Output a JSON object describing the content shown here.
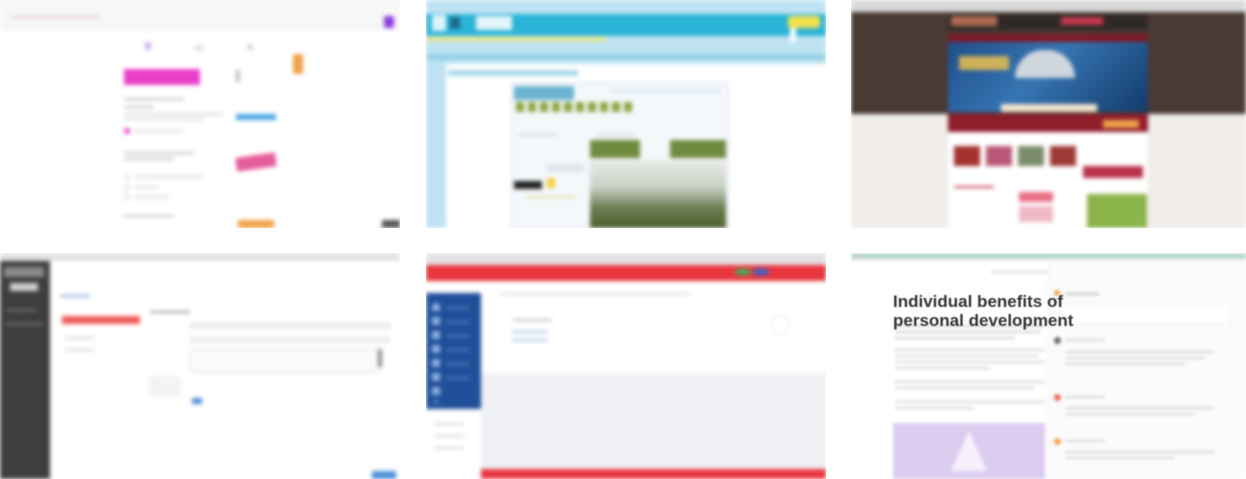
{
  "thumbnails": [
    {
      "id": "t1",
      "kind": "survey-form"
    },
    {
      "id": "t2",
      "kind": "library-portal"
    },
    {
      "id": "t3",
      "kind": "university-homepage"
    },
    {
      "id": "t4",
      "kind": "admin-form"
    },
    {
      "id": "t5",
      "kind": "learning-dashboard"
    },
    {
      "id": "t6",
      "kind": "article-with-comments",
      "article": {
        "title_line1": "Individual benefits of",
        "title_line2": "personal development"
      }
    }
  ],
  "colors": {
    "magenta": "#e83fc8",
    "purple": "#8b3fe0",
    "cyan": "#2bb4d8",
    "yellow": "#f4e24a",
    "maroon": "#8f1d2c",
    "dark_sidebar": "#3e3e3e",
    "red": "#e8363f",
    "navy": "#1f4f99",
    "lavender": "#dccdf0",
    "orange": "#f0a24a"
  }
}
